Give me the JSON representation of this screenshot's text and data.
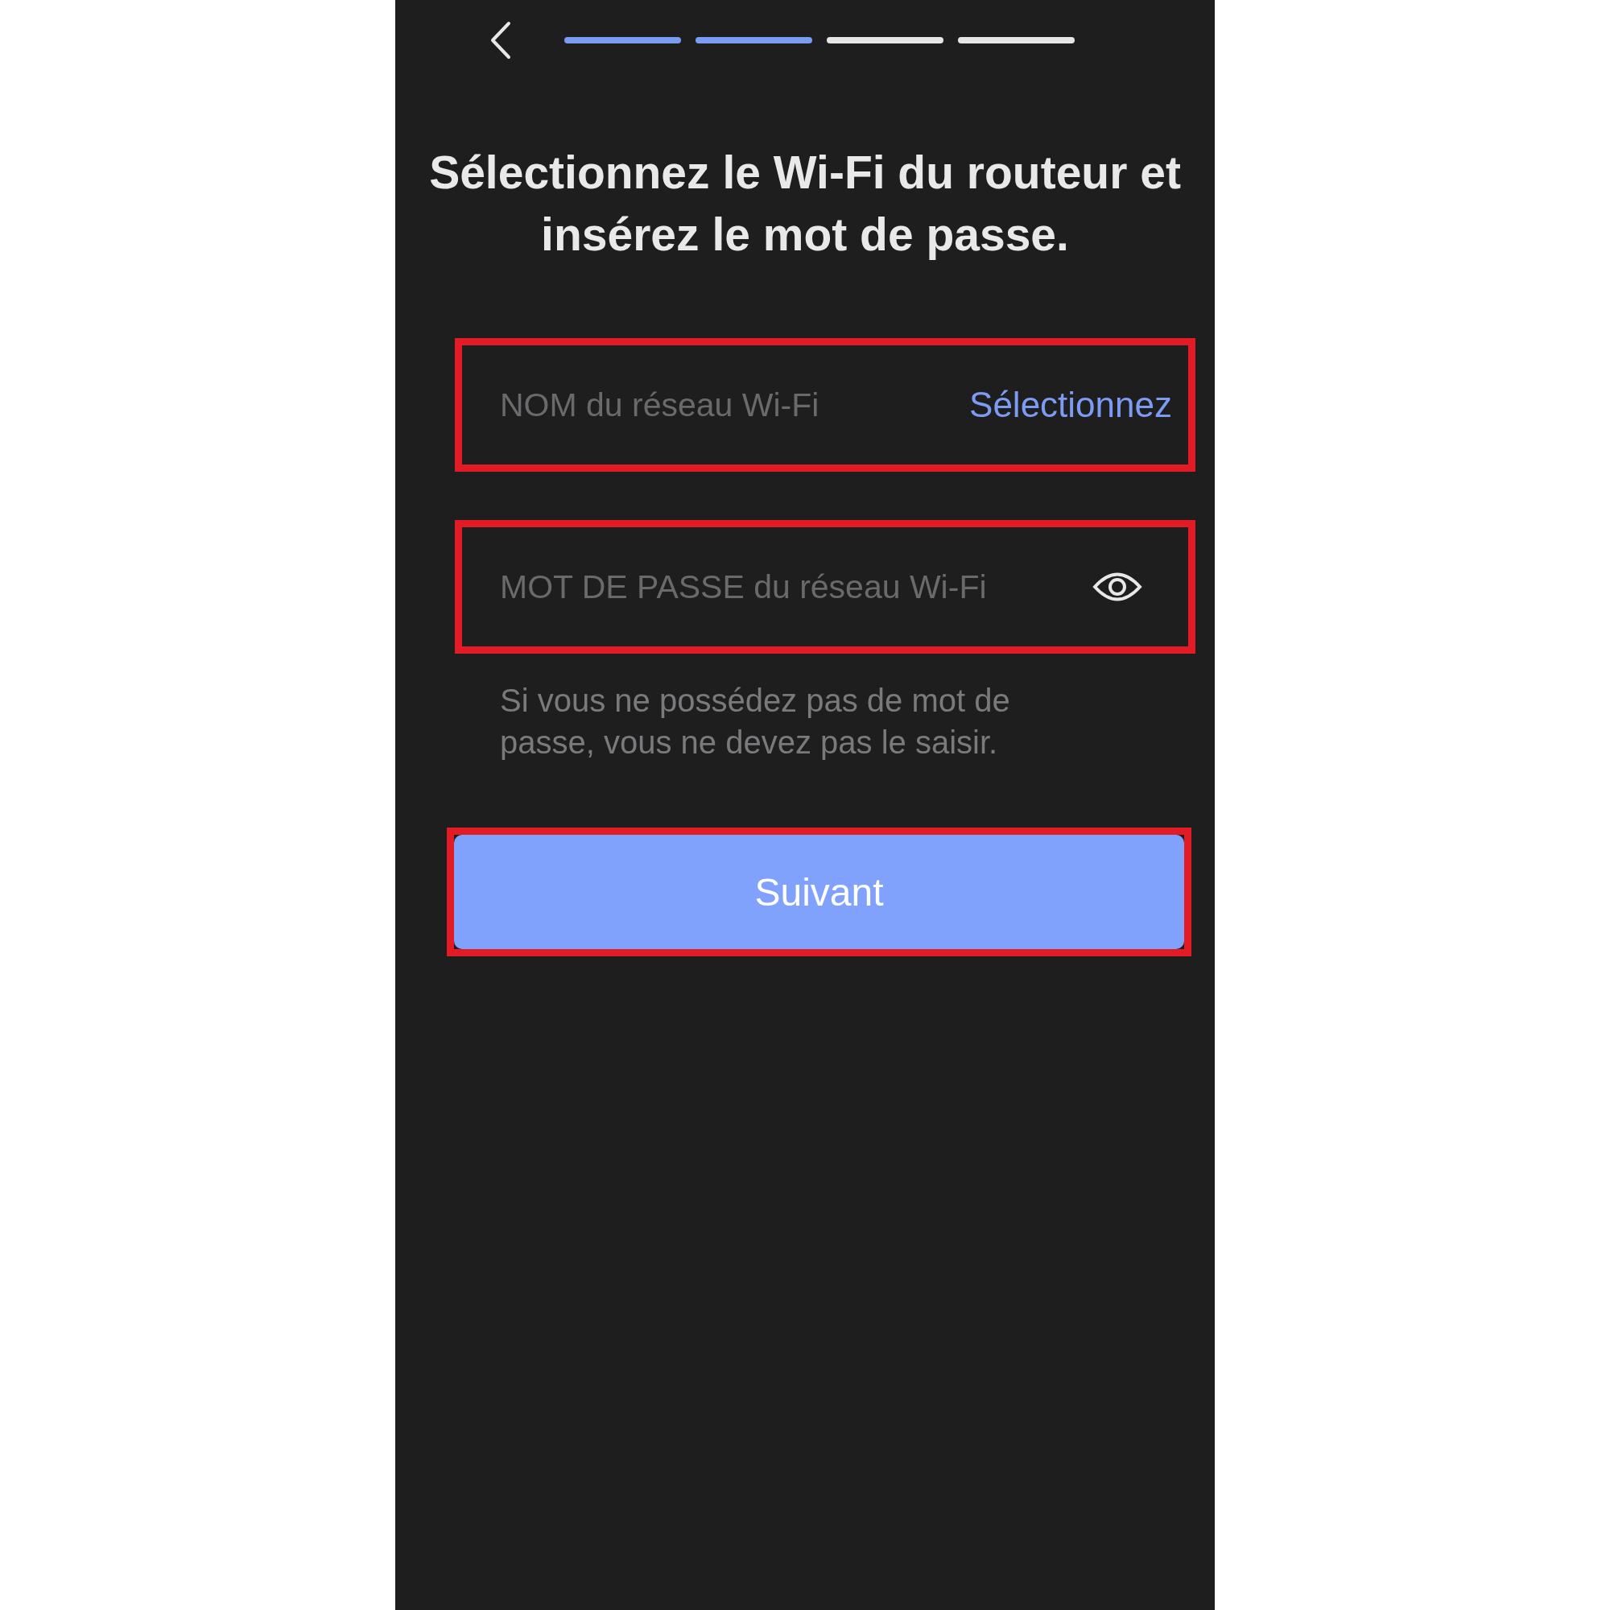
{
  "progress": [
    {
      "done": true
    },
    {
      "done": true
    },
    {
      "done": false
    },
    {
      "done": false
    }
  ],
  "title_lines": [
    "Sélectionnez le Wi-Fi du routeur et",
    "insérez le mot de passe."
  ],
  "fields": [
    {
      "kind": "select",
      "placeholder": "NOM du réseau Wi-Fi",
      "action": "Sélectionnez",
      "highlighted": true
    },
    {
      "kind": "password",
      "placeholder": "MOT DE PASSE du réseau Wi-Fi",
      "highlighted": true
    }
  ],
  "hint": "Si vous ne possédez pas de mot de passe, vous ne devez pas le saisir.",
  "button": {
    "label": "Suivant",
    "highlighted": true
  }
}
